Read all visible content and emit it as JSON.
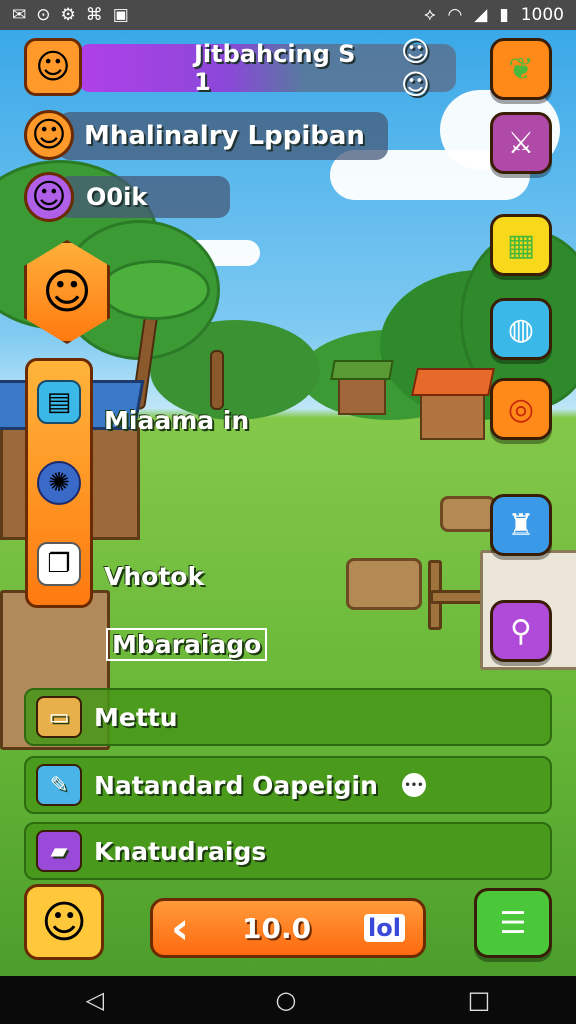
{
  "status_bar": {
    "left_icons": [
      "mail-icon",
      "alarm-icon",
      "settings-icon",
      "game-icon",
      "image-icon"
    ],
    "time": "1000"
  },
  "player": {
    "title": "Jitbahcing  S 1",
    "name": "Mhalinalry  Lppiban",
    "rank": "O0ik"
  },
  "left_column": {
    "items": [
      "card-icon",
      "compass-icon",
      "chat-icon"
    ]
  },
  "labels": {
    "main_1": "Miaama  in",
    "main_2": "Vhotok",
    "main_3": "Mbaraiago"
  },
  "bars": [
    {
      "label": "Mettu",
      "icon": "folder-icon",
      "color": "#e8b04a"
    },
    {
      "label": "Natandard  Oapeigin",
      "icon": "pencil-icon",
      "color": "#4ab4e8",
      "extra": "•••"
    },
    {
      "label": "Knatudraigs",
      "icon": "box-icon",
      "color": "#9a4ad8"
    }
  ],
  "right_buttons": [
    {
      "icon": "leaf-icon",
      "color": "#ff8a1a"
    },
    {
      "icon": "swords-icon",
      "color": "#b04aa8"
    },
    {
      "icon": "chest-icon",
      "color": "#f8d81a"
    },
    {
      "icon": "chat-bubble-icon",
      "color": "#3ab8e8"
    },
    {
      "icon": "target-icon",
      "color": "#ff8a1a"
    },
    {
      "icon": "trash-icon",
      "color": "#3a9ae8"
    },
    {
      "icon": "search-icon",
      "color": "#b04ad8"
    }
  ],
  "bottom": {
    "value": "10.0",
    "back_glyph": "‹",
    "stats_glyph": "lol",
    "menu_glyph": "☰"
  },
  "nav": {
    "back": "◁",
    "home": "○",
    "recent": "□"
  }
}
